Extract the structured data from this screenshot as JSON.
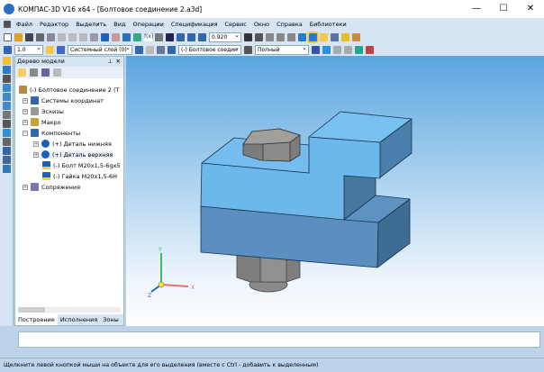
{
  "window": {
    "title": "КОМПАС-3D V16  x64 - [Болтовое соединение 2.a3d]"
  },
  "menu": [
    "Файл",
    "Редактор",
    "Выделить",
    "Вид",
    "Операции",
    "Спецификация",
    "Сервис",
    "Окно",
    "Справка",
    "Библиотеки"
  ],
  "toolbar": {
    "zoom_value": "0.920",
    "line_width": "1.0",
    "layer": "Системный слой (0)",
    "part": "(-) Болтовое соедин",
    "style": "Полный"
  },
  "tree": {
    "title": "Дерево модели",
    "root": "(-) Болтовое соединение 2 (Т",
    "items": [
      "Системы координат",
      "Эскизы",
      "Макро",
      "Компоненты",
      "(+) Деталь нижняя",
      "(+) Деталь верхняя",
      "(-) Болт M20x1,5-6gx5",
      "(-) Гайка M20x1,5-6H",
      "Сопряжения"
    ],
    "tabs": [
      "Построение",
      "Исполнения",
      "Зоны"
    ]
  },
  "axes": {
    "x": "X",
    "y": "Y",
    "z": "Z"
  },
  "status": "Щелкните левой кнопкой мыши на объекте для его выделения (вместе с Ctrl - добавить к выделенным)"
}
